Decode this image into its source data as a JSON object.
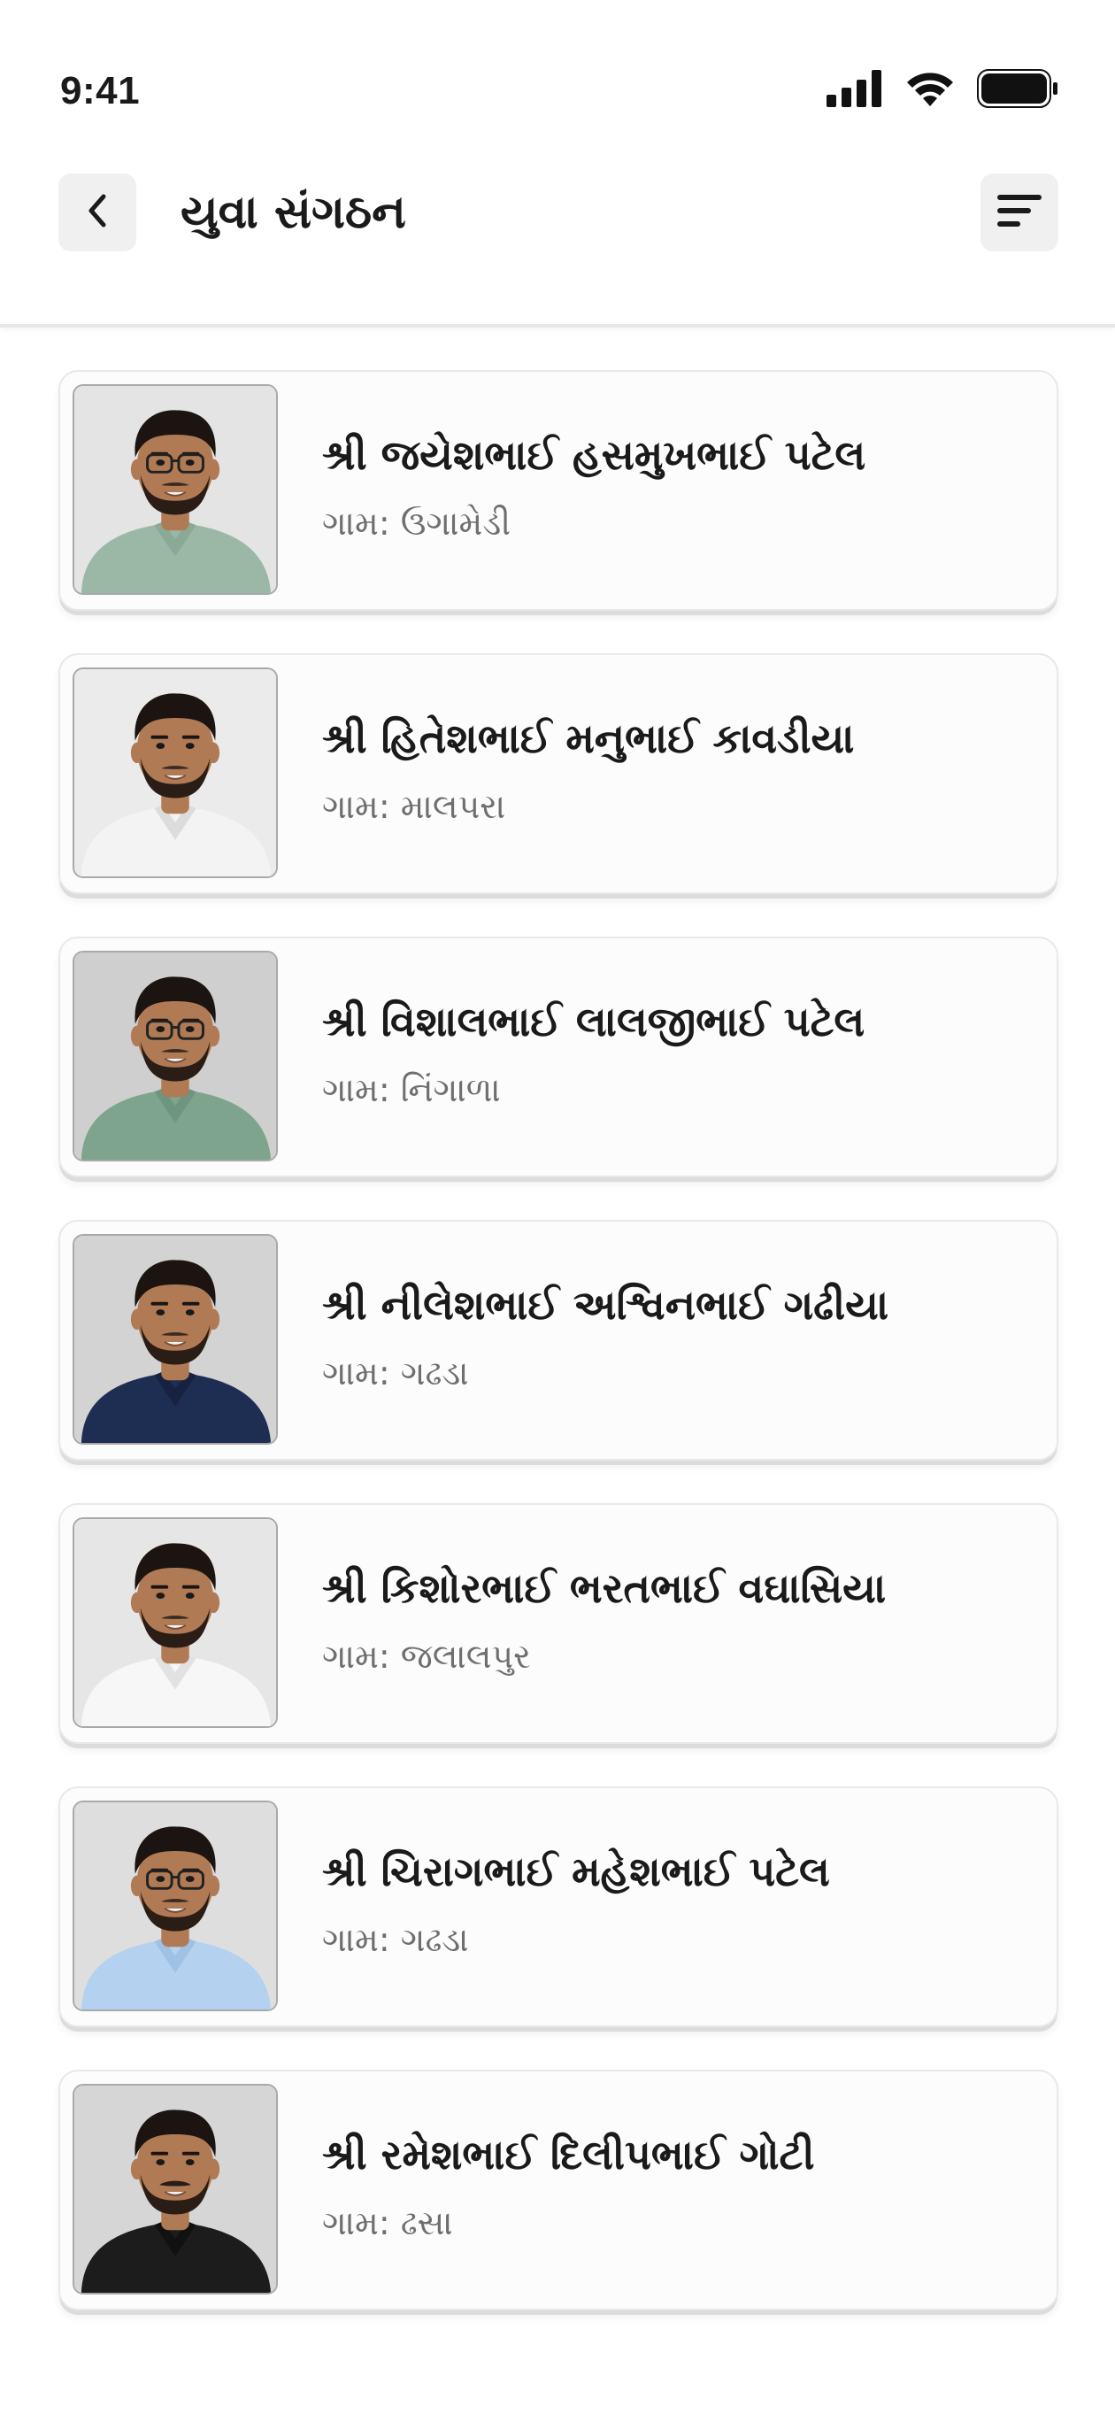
{
  "status_bar": {
    "time": "9:41",
    "icons": [
      "signal-icon",
      "wifi-icon",
      "battery-icon"
    ]
  },
  "header": {
    "title": "યુવા સંગઠન",
    "back_icon": "chevron-left-icon",
    "filter_icon": "sort-lines-icon"
  },
  "members": [
    {
      "name": "શ્રી જયેશભાઈ હસમુખભાઈ પટેલ",
      "village": "ગામ: ઉગામેડી",
      "photo": {
        "bg": "#e4e4e4",
        "shirt": "#9bb8a6",
        "glasses": true,
        "mustache": false,
        "collar": "#8aaa96"
      }
    },
    {
      "name": "શ્રી હિતેશભાઈ મનુભાઈ કાવડીયા",
      "village": "ગામ: માલપરા",
      "photo": {
        "bg": "#ebebeb",
        "shirt": "#f3f3f3",
        "glasses": false,
        "mustache": false,
        "collar": "#dcdcdc"
      }
    },
    {
      "name": "શ્રી વિશાલભાઈ લાલજીભાઈ પટેલ",
      "village": "ગામ: નિંગાળા",
      "photo": {
        "bg": "#cfcfcf",
        "shirt": "#7ea48d",
        "glasses": true,
        "mustache": false,
        "collar": "#6d9580"
      }
    },
    {
      "name": "શ્રી નીલેશભાઈ અશ્વિનભાઈ ગઢીયા",
      "village": "ગામ: ગઢડા",
      "photo": {
        "bg": "#d3d3d3",
        "shirt": "#1e2d52",
        "glasses": false,
        "mustache": false,
        "collar": "#16223f"
      }
    },
    {
      "name": "શ્રી કિશોરભાઈ ભરતભાઈ વઘાસિયા",
      "village": "ગામ: જલાલપુર",
      "photo": {
        "bg": "#e6e6e6",
        "shirt": "#f7f7f7",
        "glasses": false,
        "mustache": false,
        "collar": "#e2e2e2"
      }
    },
    {
      "name": "શ્રી ચિરાગભાઈ મહેશભાઈ પટેલ",
      "village": "ગામ: ગઢડા",
      "photo": {
        "bg": "#dedede",
        "shirt": "#b4d2ef",
        "glasses": true,
        "mustache": false,
        "collar": "#9fc1e3"
      }
    },
    {
      "name": "શ્રી રમેશભાઈ દિલીપભાઈ ગોટી",
      "village": "ગામ: ઢસા",
      "photo": {
        "bg": "#d6d6d6",
        "shirt": "#1c1c1c",
        "glasses": false,
        "mustache": true,
        "collar": "#111111"
      }
    }
  ]
}
